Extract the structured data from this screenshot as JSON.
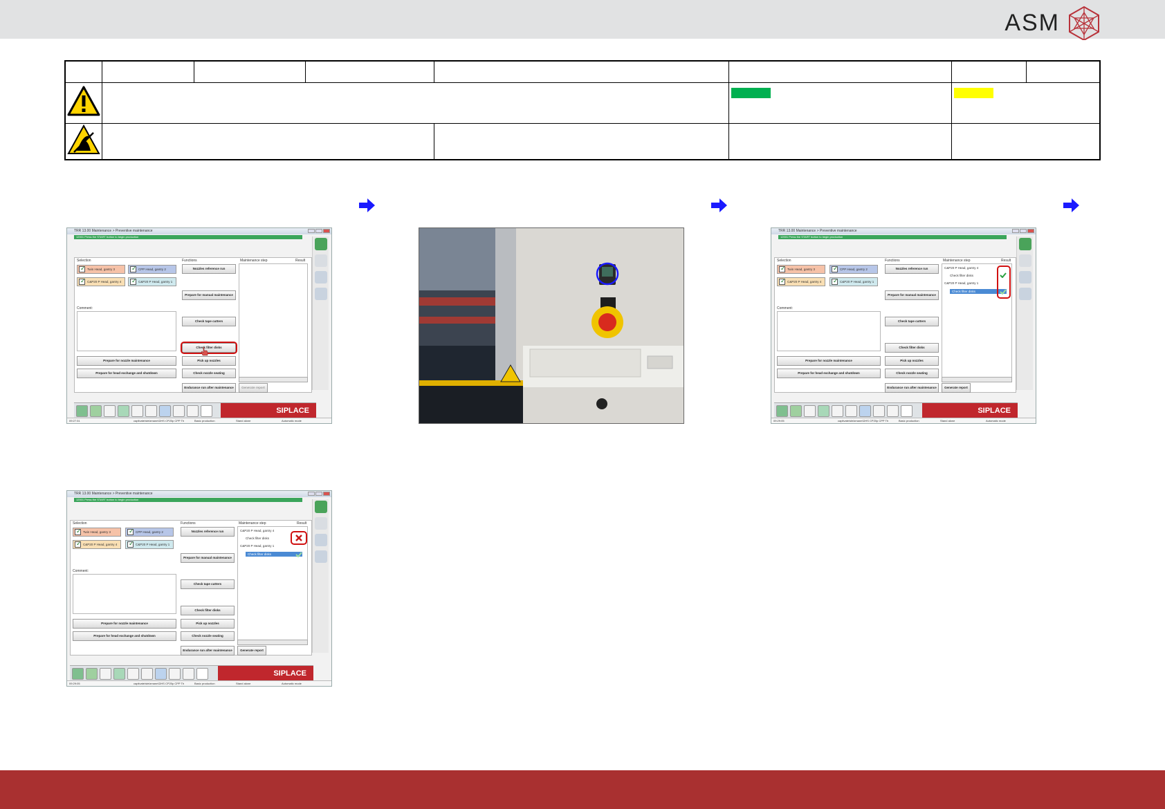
{
  "header": {
    "brand": "ASM"
  },
  "table": {
    "row1_cells": [
      "",
      "",
      "",
      "",
      "",
      "",
      "",
      ""
    ],
    "row2": {
      "text": "",
      "green_label": "",
      "yellow_label": ""
    },
    "row3_cells": [
      "",
      "",
      "",
      ""
    ]
  },
  "colors": {
    "green": "#00b050",
    "yellow": "#ffff00",
    "brand_red": "#a93030",
    "arrow": "#1a1aff"
  },
  "screens": [
    {
      "title": "TRR 13.00 Maintenance > Preventive maintenance",
      "status": "12001 Press the START button to begin production",
      "selection_label": "Selection",
      "functions_label": "Functions",
      "maintenance_label": "Maintenance step",
      "result_label": "Result",
      "comment_label": "Comment:",
      "heads": [
        "Twin Head, gantry 3",
        "CPP Head, gantry 2",
        "C&P20 P Head, gantry 4",
        "C&P20 P Head, gantry 1"
      ],
      "buttons": {
        "nozzle_ref": "Nozzles reference run",
        "manual": "Prepare for manual maintenance",
        "tape": "Check tape cutters",
        "filter": "Check filter disks",
        "pickup": "Pick up nozzles",
        "seating": "Check nozzle seating",
        "endurance": "Endurance run after maintenance",
        "report": "Generate report",
        "nozzle_maint": "Prepare for nozzle maintenance",
        "head_exchange": "Prepare for head exchange and shutdown"
      },
      "steps": [],
      "footer": {
        "time": "09:27:31",
        "path": "captivate/stelzmann\\DHS CP20p CPP Th",
        "mode1": "Basic production",
        "mode2": "Stand alone",
        "mode3": "Automatic mode"
      },
      "brand": "SIPLACE"
    },
    {
      "title": "TRR 13.00 Maintenance > Preventive maintenance",
      "status": "12001 Press the START button to begin production",
      "selection_label": "Selection",
      "functions_label": "Functions",
      "maintenance_label": "Maintenance step",
      "result_label": "Result",
      "comment_label": "Comment:",
      "heads": [
        "Twin Head, gantry 3",
        "CPP Head, gantry 2",
        "C&P20 P Head, gantry 4",
        "C&P20 P Head, gantry 1"
      ],
      "buttons": {
        "nozzle_ref": "Nozzles reference run",
        "manual": "Prepare for manual maintenance",
        "tape": "Check tape cutters",
        "filter": "Check filter disks",
        "pickup": "Pick up nozzles",
        "seating": "Check nozzle seating",
        "endurance": "Endurance run after maintenance",
        "report": "Generate report",
        "nozzle_maint": "Prepare for nozzle maintenance",
        "head_exchange": "Prepare for head exchange and shutdown"
      },
      "steps": [
        "C&P20 P Head, gantry 4",
        "Check filter disks",
        "C&P20 P Head, gantry 1",
        "Check filter disks"
      ],
      "footer": {
        "time": "09:29:05",
        "path": "captivate/stelzmann\\DHS CP20p CPP Th",
        "mode1": "Basic production",
        "mode2": "Stand alone",
        "mode3": "Automatic mode"
      },
      "brand": "SIPLACE"
    },
    {
      "title": "TRR 13.00 Maintenance > Preventive maintenance",
      "status": "12001 Press the START button to begin production",
      "selection_label": "Selection",
      "functions_label": "Functions",
      "maintenance_label": "Maintenance step",
      "result_label": "Result",
      "comment_label": "Comment:",
      "heads": [
        "Twin Head, gantry 3",
        "CPP Head, gantry 2",
        "C&P20 P Head, gantry 4",
        "C&P20 P Head, gantry 1"
      ],
      "buttons": {
        "nozzle_ref": "Nozzles reference run",
        "manual": "Prepare for manual maintenance",
        "tape": "Check tape cutters",
        "filter": "Check filter disks",
        "pickup": "Pick up nozzles",
        "seating": "Check nozzle seating",
        "endurance": "Endurance run after maintenance",
        "report": "Generate report",
        "nozzle_maint": "Prepare for nozzle maintenance",
        "head_exchange": "Prepare for head exchange and shutdown"
      },
      "steps": [
        "C&P20 P Head, gantry 4",
        "Check filter disks",
        "C&P20 P Head, gantry 1",
        "Check filter disks"
      ],
      "footer": {
        "time": "09:29:05",
        "path": "captivate/stelzmann\\DHS CP20p CPP Th",
        "mode1": "Basic production",
        "mode2": "Stand alone",
        "mode3": "Automatic mode"
      },
      "brand": "SIPLACE"
    }
  ]
}
